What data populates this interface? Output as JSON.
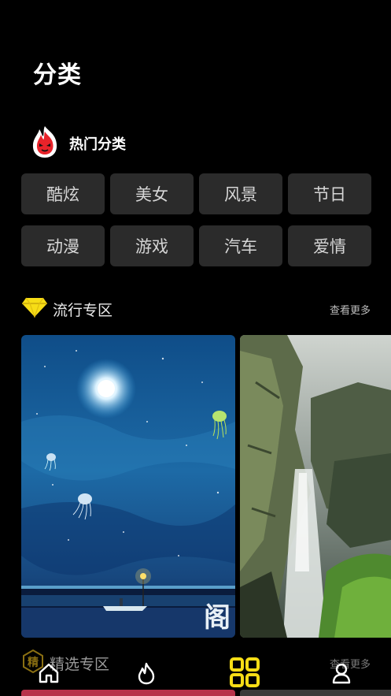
{
  "page": {
    "title": "分类"
  },
  "hot": {
    "label": "热门分类",
    "icon": "flame-mascot-icon",
    "categories": [
      "酷炫",
      "美女",
      "风景",
      "节日",
      "动漫",
      "游戏",
      "汽车",
      "爱情"
    ]
  },
  "popular": {
    "label": "流行专区",
    "icon": "diamond-icon",
    "more": "查看更多",
    "items": [
      {
        "image": "jellyfish-night-sea-wallpaper",
        "signature": "阁"
      },
      {
        "image": "waterfall-cliff-wallpaper"
      }
    ]
  },
  "featured": {
    "label": "精选专区",
    "badge": "精",
    "more": "查看更多"
  },
  "tabbar": {
    "tabs": [
      {
        "icon": "home-icon",
        "active": false
      },
      {
        "icon": "flame-icon",
        "active": false
      },
      {
        "icon": "category-grid-icon",
        "active": true
      },
      {
        "icon": "user-icon",
        "active": false
      }
    ],
    "active_color": "#f7dd16"
  },
  "colors": {
    "background": "#000000",
    "chip": "#2b2b2b",
    "accent": "#f7dd16"
  }
}
